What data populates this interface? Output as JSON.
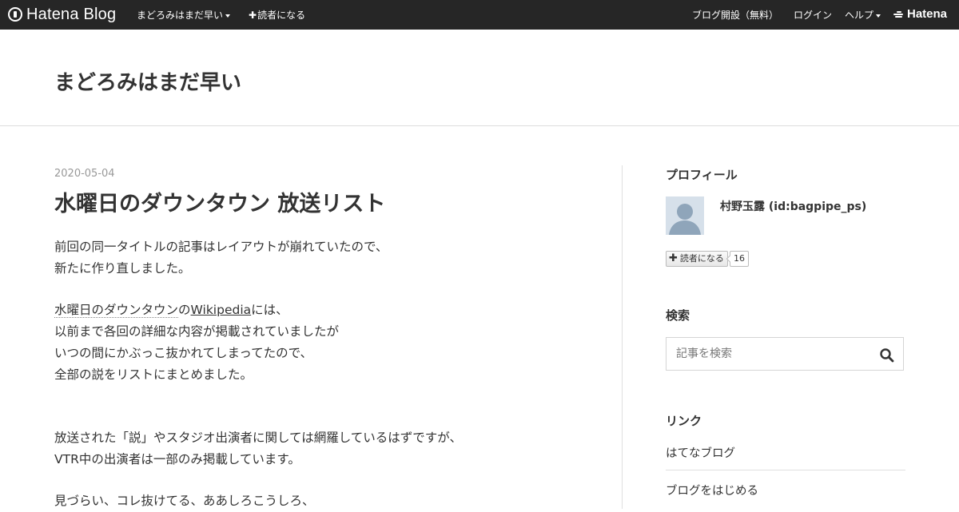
{
  "topbar": {
    "logo_text": "Hatena Blog",
    "blog_menu_label": "まどろみはまだ早い",
    "subscribe_label": "読者になる",
    "open_blog_label": "ブログ開設（無料）",
    "login_label": "ログイン",
    "help_label": "ヘルプ",
    "hatena_label": "Hatena"
  },
  "header": {
    "blog_title": "まどろみはまだ早い"
  },
  "entry": {
    "date": "2020-05-04",
    "title": "水曜日のダウンタウン 放送リスト",
    "p1_line1": "前回の同一タイトルの記事はレイアウトが崩れていたので、",
    "p1_line2": "新たに作り直しました。",
    "p2_keyword": "水曜日のダウンタウン",
    "p2_no": "の",
    "p2_link": "Wikipedia",
    "p2_rest": "には、",
    "p2_line2": "以前まで各回の詳細な内容が掲載されていましたが",
    "p2_line3": "いつの間にかぶっこ抜かれてしまってたので、",
    "p2_line4": "全部の説をリストにまとめました。",
    "p3_line1": "放送された「説」やスタジオ出演者に関しては網羅しているはずですが、",
    "p3_line2": "VTR中の出演者は一部のみ掲載しています。",
    "p4_line1": "見づらい、コレ抜けてる、ああしろこうしろ、"
  },
  "sidebar": {
    "profile_heading": "プロフィール",
    "profile_name": "村野玉露 (id:bagpipe_ps)",
    "subscribe_button": "読者になる",
    "subscriber_count": "16",
    "search_heading": "検索",
    "search_placeholder": "記事を検索",
    "links_heading": "リンク",
    "links": [
      {
        "label": "はてなブログ"
      },
      {
        "label": "ブログをはじめる"
      }
    ]
  },
  "colors": {
    "topbar_bg": "#262626",
    "text": "#333333",
    "date": "#999999",
    "divider": "#dddddd"
  }
}
